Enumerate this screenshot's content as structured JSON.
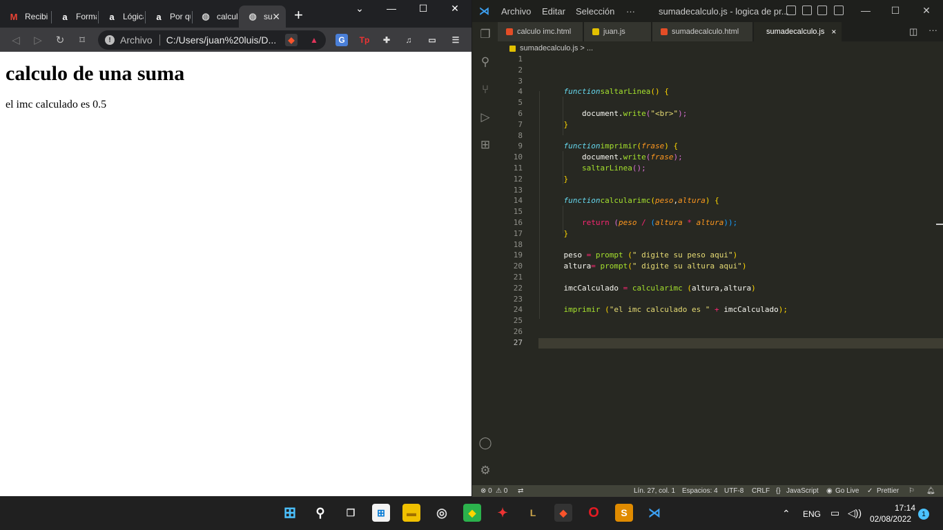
{
  "browser": {
    "tabs": [
      {
        "label": "Recibi",
        "icon": "gmail-icon"
      },
      {
        "label": "Forma",
        "icon": "a-logo-icon"
      },
      {
        "label": "Lógica",
        "icon": "a-logo-icon"
      },
      {
        "label": "Por qu",
        "icon": "a-logo-icon"
      },
      {
        "label": "calcul",
        "icon": "globe-icon"
      },
      {
        "label": "su",
        "icon": "globe-icon"
      }
    ],
    "new_tab": "+",
    "address_scheme": "Archivo",
    "address_url": "C:/Users/juan%20luis/D...",
    "page": {
      "heading": "calculo de una suma",
      "text": "el imc calculado es 0.5"
    }
  },
  "vscode": {
    "menu": [
      "Archivo",
      "Editar",
      "Selección",
      "···"
    ],
    "window_title": "sumadecalculo.js - logica de pr...",
    "tabs": [
      {
        "label": "calculo imc.html",
        "icon_color": "#e44d26"
      },
      {
        "label": "juan.js",
        "icon_color": "#e2c000"
      },
      {
        "label": "sumadecalculo.html",
        "icon_color": "#e44d26"
      },
      {
        "label": "sumadecalculo.js",
        "icon_color": "#e2c000",
        "close": "×"
      }
    ],
    "breadcrumb": "sumadecalculo.js > ...",
    "line_numbers": [
      "1",
      "2",
      "3",
      "4",
      "5",
      "6",
      "7",
      "8",
      "9",
      "10",
      "11",
      "12",
      "13",
      "14",
      "15",
      "16",
      "17",
      "18",
      "19",
      "20",
      "21",
      "22",
      "23",
      "24",
      "25",
      "26",
      "27"
    ],
    "code": {
      "l4": [
        "function",
        "saltarLinea",
        "() {"
      ],
      "l6": [
        "document.",
        "write",
        "(",
        "\"<br>\"",
        ");"
      ],
      "l7": "}",
      "l9": [
        "function",
        "imprimir",
        "(",
        "frase",
        ") {"
      ],
      "l10": [
        "document.",
        "write",
        "(",
        "frase",
        ");"
      ],
      "l11": [
        "saltarLinea",
        "();"
      ],
      "l12": "}",
      "l14": [
        "function",
        "calcularimc",
        "(",
        "peso",
        ",",
        "altura",
        ") {"
      ],
      "l16": [
        "return",
        " (",
        "peso",
        " / ",
        "(",
        "altura",
        " * ",
        "altura",
        "));"
      ],
      "l17": "}",
      "l19": [
        "peso",
        " = ",
        "prompt",
        " (",
        "\" digite su peso aqui\"",
        ")"
      ],
      "l20": [
        "altura",
        "= ",
        "prompt",
        "(",
        "\" digite su altura aqui\"",
        ")"
      ],
      "l22": [
        "imcCalculado",
        " = ",
        "calcularimc",
        " (",
        "altura,altura",
        ")"
      ],
      "l24": [
        "imprimir",
        " (",
        "\"el imc calculado es \"",
        " + ",
        "imcCalculado",
        ");"
      ]
    },
    "status": {
      "errors": "⊗ 0",
      "warnings": "⚠ 0",
      "position": "Lín. 27, col. 1",
      "spaces": "Espacios: 4",
      "encoding": "UTF-8",
      "eol": "CRLF",
      "language": "JavaScript",
      "golive": "Go Live",
      "prettier": "Prettier"
    }
  },
  "taskbar": {
    "language": "ENG",
    "time": "17:14",
    "date": "02/08/2022",
    "notifications": "1"
  }
}
